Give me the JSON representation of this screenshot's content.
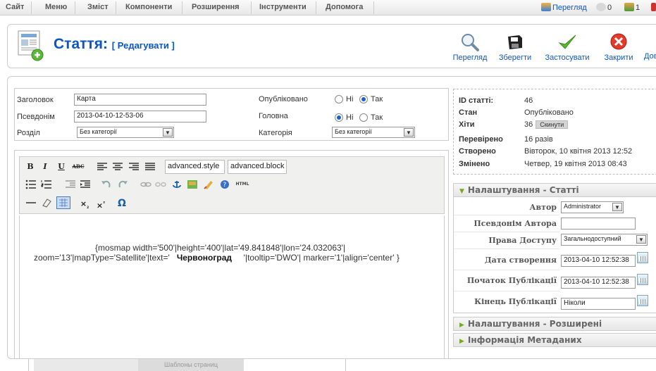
{
  "menu": {
    "items": [
      "Сайт",
      "Меню",
      "Зміст",
      "Компоненти",
      "Розширення",
      "Інструменти",
      "Допомога"
    ],
    "preview_link": "Перегляд",
    "messages_count": "0",
    "users_count": "1"
  },
  "header": {
    "title": "Стаття:",
    "subtitle": "[ Редагувати ]"
  },
  "toolbar": {
    "preview": "Перегляд",
    "save": "Зберегти",
    "apply": "Застосувати",
    "close": "Закрити",
    "help": "Довідка"
  },
  "details": {
    "title_label": "Заголовок",
    "title_value": "Карта",
    "alias_label": "Псевдонім",
    "alias_value": "2013-04-10-12-53-06",
    "section_label": "Розділ",
    "section_value": "Без категорії",
    "published_label": "Опубліковано",
    "frontpage_label": "Головна",
    "no": "Ні",
    "yes": "Так",
    "category_label": "Категорія",
    "category_value": "Без категорії"
  },
  "editor": {
    "style_select": "advanced.style",
    "block_select": "advanced.block",
    "content_line1": "{mosmap width='500'|height='400'|lat='49.841848'|lon='24.032063'|",
    "content_line2a": "zoom='13'|mapType='Satellite'|text='",
    "content_line2b": "Червоноград",
    "content_line2c": "'|tooltip='DWO'| marker='1'|align='center' }"
  },
  "info": {
    "id_label": "ID статті:",
    "id_value": "46",
    "state_label": "Стан",
    "state_value": "Опубліковано",
    "hits_label": "Хіти",
    "hits_value": "36",
    "reset_label": "Скинути",
    "revised_label": "Перевірено",
    "revised_value": "16 разів",
    "created_label": "Створено",
    "created_value": "Вівторок, 10 квітня 2013 12:52",
    "modified_label": "Змінено",
    "modified_value": "Четвер, 19 квітня 2013 08:43"
  },
  "params": {
    "header": "Налаштування - Статті",
    "author_label": "Автор",
    "author_value": "Administrator",
    "alias_label": "Псевдонім Автора",
    "access_label": "Права Доступу",
    "access_value": "Загальнодоступний",
    "created_label": "Дата створення",
    "created_value": "2013-04-10 12:52:38",
    "publish_up_label": "Початок Публікації",
    "publish_up_value": "2013-04-10 12:52:38",
    "publish_down_label": "Кінець Публікації",
    "publish_down_value": "Ніколи"
  },
  "accordion": {
    "advanced": "Налаштування - Розширені",
    "metadata": "Інформація Метаданих"
  },
  "bottom": {
    "fragment_text": "Шаблоны страниц"
  }
}
